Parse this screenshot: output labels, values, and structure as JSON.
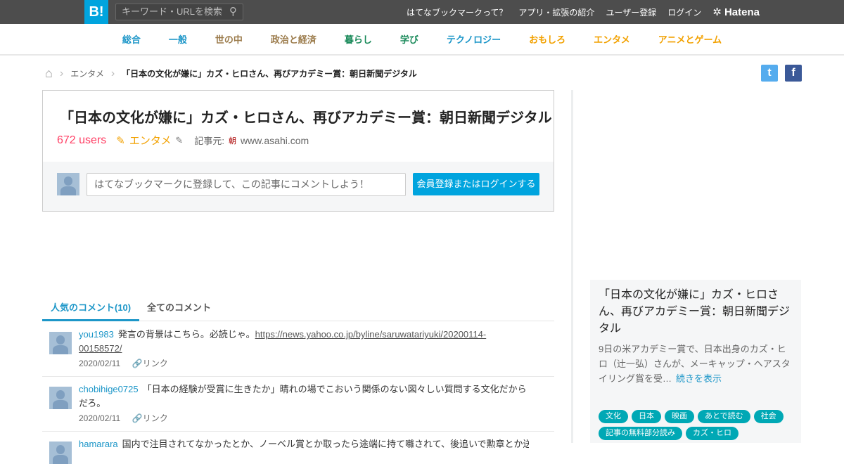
{
  "header": {
    "logo": "B!",
    "search_placeholder": "キーワード・URLを検索",
    "links": [
      "はてなブックマークって？",
      "アプリ・拡張の紹介",
      "ユーザー登録",
      "ログイン"
    ],
    "brand": "Hatena"
  },
  "categories": [
    {
      "label": "総合",
      "color": "#1c96c8"
    },
    {
      "label": "一般",
      "color": "#1c96c8"
    },
    {
      "label": "世の中",
      "color": "#9b7b4b"
    },
    {
      "label": "政治と経済",
      "color": "#9b7b4b"
    },
    {
      "label": "暮らし",
      "color": "#1a8a5a"
    },
    {
      "label": "学び",
      "color": "#1a8a5a"
    },
    {
      "label": "テクノロジー",
      "color": "#1c96c8"
    },
    {
      "label": "おもしろ",
      "color": "#f2a100"
    },
    {
      "label": "エンタメ",
      "color": "#f2a100"
    },
    {
      "label": "アニメとゲーム",
      "color": "#f2a100"
    }
  ],
  "breadcrumb": {
    "category": "エンタメ",
    "current": "「日本の文化が嫌に」カズ・ヒロさん、再びアカデミー賞：朝日新聞デジタル"
  },
  "share": {
    "twitter": "t",
    "facebook": "f"
  },
  "entry": {
    "title": "「日本の文化が嫌に」カズ・ヒロさん、再びアカデミー賞：朝日新聞デジタル",
    "users": "672 users",
    "category": "エンタメ",
    "source_label": "記事元:",
    "source_icon": "朝",
    "source": "www.asahi.com"
  },
  "comment_form": {
    "placeholder": "はてなブックマークに登録して、この記事にコメントしよう！",
    "button": "会員登録またはログインする"
  },
  "tabs": {
    "popular": "人気のコメント(10)",
    "all": "全てのコメント"
  },
  "comments": [
    {
      "user": "you1983",
      "text": "発言の背景はこちら。必読じゃ。",
      "link": "https://news.yahoo.co.jp/byline/saruwatariyuki/20200114-00158572/",
      "date": "2020/02/11",
      "link_label": "リンク"
    },
    {
      "user": "chobihige0725",
      "text": "「日本の経験が受賞に生きたか」晴れの場でこおいう関係のない図々しい質問する文化だからだろ。",
      "date": "2020/02/11",
      "link_label": "リンク"
    },
    {
      "user": "hamarara",
      "text": "国内で注目されてなかったとか、ノーベル賞とか取ったら途端に持て囃されて、後追いで勲章とか送"
    }
  ],
  "sidebar": {
    "title": "「日本の文化が嫌に」カズ・ヒロさん、再びアカデミー賞：朝日新聞デジタル",
    "summary": "9日の米アカデミー賞で、日本出身のカズ・ヒロ（辻一弘）さんが、メーキャップ・ヘアスタイリング賞を受…",
    "more": "続きを表示",
    "tags": [
      "文化",
      "日本",
      "映画",
      "あとで読む",
      "社会",
      "記事の無料部分読み",
      "カズ・ヒロ"
    ]
  }
}
